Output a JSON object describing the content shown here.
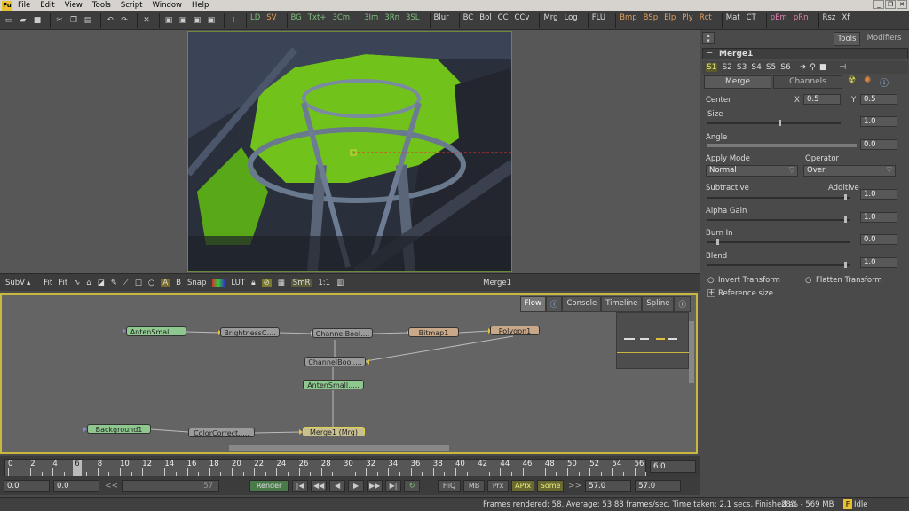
{
  "menu": {
    "logo": "Fu",
    "items": [
      "File",
      "Edit",
      "View",
      "Tools",
      "Script",
      "Window",
      "Help"
    ]
  },
  "toolbar": {
    "buttons": [
      "LD",
      "SV",
      "BG",
      "Txt+",
      "3Cm",
      "3Im",
      "3Rn",
      "3SL",
      "Blur",
      "BC",
      "Bol",
      "CC",
      "CCv",
      "Mrg",
      "Log",
      "FLU",
      "Bmp",
      "BSp",
      "Elp",
      "Ply",
      "Rct",
      "Mat",
      "CT",
      "pEm",
      "pRn",
      "Rsz",
      "Xf"
    ],
    "colors": {
      "LD": "#7ec07e",
      "SV": "#e0a060",
      "BG": "#7ec07e",
      "Txt+": "#7ec07e",
      "3Cm": "#7ec07e",
      "3Im": "#7ec07e",
      "3Rn": "#7ec07e",
      "3SL": "#7ec07e",
      "Bmp": "#e0a060",
      "BSp": "#e0a060",
      "Elp": "#e0a060",
      "Ply": "#e0a060",
      "Rct": "#e0a060",
      "pEm": "#e080b0",
      "pRn": "#e080b0"
    }
  },
  "viewer": {
    "toolbar": [
      "SubV",
      "Fit",
      "Fit",
      "A",
      "B",
      "Snap",
      "LUT",
      "SmR",
      "1:1"
    ],
    "node_name": "Merge1"
  },
  "flow": {
    "tabs": [
      "Flow",
      "Console",
      "Timeline",
      "Spline"
    ],
    "nodes": [
      "AntenSmall.....",
      "BrightnessC....",
      "ChannelBool....",
      "Bitmap1",
      "Polygon1",
      "ChannelBool....",
      "AntenSmall.....",
      "Background1",
      "ColorCorrect.....",
      "Merge1 (Mrg)"
    ]
  },
  "timeline": {
    "ticks": [
      "0",
      "2",
      "4",
      "6",
      "8",
      "10",
      "12",
      "14",
      "16",
      "18",
      "20",
      "22",
      "24",
      "26",
      "28",
      "30",
      "32",
      "34",
      "36",
      "38",
      "40",
      "42",
      "44",
      "46",
      "48",
      "50",
      "52",
      "54",
      "56"
    ],
    "current": "6",
    "end_value": "6.0",
    "start": "0.0",
    "start2": "0.0",
    "range_end": "57",
    "render": "Render",
    "buttons": [
      "HiQ",
      "MB",
      "Prx",
      "APrx",
      "Some"
    ],
    "global_end": "57.0",
    "global_end2": "57.0"
  },
  "status": {
    "text": "Frames rendered: 58,  Average: 53.88 frames/sec,  Time taken: 2.1 secs,  Finished at",
    "mem": "28% - 569 MB",
    "state": "Idle"
  },
  "panel": {
    "tabs": [
      "Tools",
      "Modifiers"
    ],
    "title": "Merge1",
    "scripts": [
      "S1",
      "S2",
      "S3",
      "S4",
      "S5",
      "S6"
    ],
    "subtabs": [
      "Merge",
      "Channels"
    ],
    "center_label": "Center",
    "x_label": "X",
    "x_val": "0.5",
    "y_label": "Y",
    "y_val": "0.5",
    "size_label": "Size",
    "size_val": "1.0",
    "angle_label": "Angle",
    "angle_val": "0.0",
    "apply_mode_label": "Apply Mode",
    "apply_mode_val": "Normal",
    "operator_label": "Operator",
    "operator_val": "Over",
    "subtractive": "Subtractive",
    "additive": "Additive",
    "additive_val": "1.0",
    "alpha_gain": "Alpha Gain",
    "alpha_gain_val": "1.0",
    "burn_in": "Burn In",
    "burn_in_val": "0.0",
    "blend": "Blend",
    "blend_val": "1.0",
    "invert": "Invert Transform",
    "flatten": "Flatten Transform",
    "ref_size": "Reference size"
  }
}
